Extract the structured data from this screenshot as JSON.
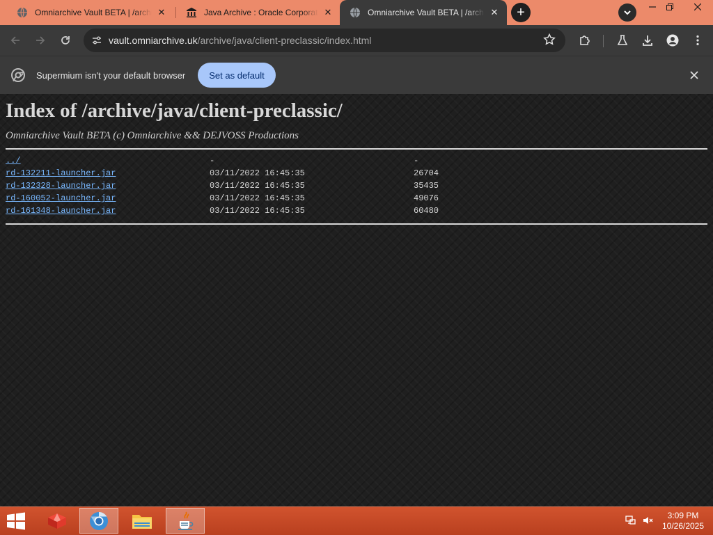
{
  "browser": {
    "tabs": [
      {
        "title": "Omniarchive Vault BETA | /archive/java/client-preclassic/",
        "favicon": "globe-icon",
        "active": false
      },
      {
        "title": "Java Archive : Oracle Corporation",
        "favicon": "bank-icon",
        "active": false
      },
      {
        "title": "Omniarchive Vault BETA | /archive/java/client-preclassic/",
        "favicon": "globe-icon",
        "active": true
      }
    ],
    "new_tab_symbol": "+",
    "url_host": "vault.omniarchive.uk",
    "url_path": "/archive/java/client-preclassic/index.html",
    "infobar_message": "Supermium isn't your default browser",
    "infobar_button": "Set as default"
  },
  "page": {
    "heading": "Index of /archive/java/client-preclassic/",
    "subtitle": "Omniarchive Vault BETA (c) Omniarchive && DEJVOSS Productions",
    "rows": [
      {
        "name": "../",
        "date": "-",
        "size": "-"
      },
      {
        "name": "rd-132211-launcher.jar",
        "date": "03/11/2022 16:45:35",
        "size": "26704"
      },
      {
        "name": "rd-132328-launcher.jar",
        "date": "03/11/2022 16:45:35",
        "size": "35435"
      },
      {
        "name": "rd-160052-launcher.jar",
        "date": "03/11/2022 16:45:35",
        "size": "49076"
      },
      {
        "name": "rd-161348-launcher.jar",
        "date": "03/11/2022 16:45:35",
        "size": "60480"
      }
    ]
  },
  "taskbar": {
    "apps": [
      "package-icon",
      "chrome-browser-icon",
      "file-explorer-icon",
      "java-icon"
    ],
    "time": "3:09 PM",
    "date": "10/26/2025"
  },
  "colors": {
    "title_bar": "#ec8a6a",
    "toolbar": "#3a3a3a",
    "page_background": "#1f1f1f",
    "link": "#79b8ff",
    "infobar_button": "#a8c7fa",
    "taskbar": "#c7492a"
  }
}
